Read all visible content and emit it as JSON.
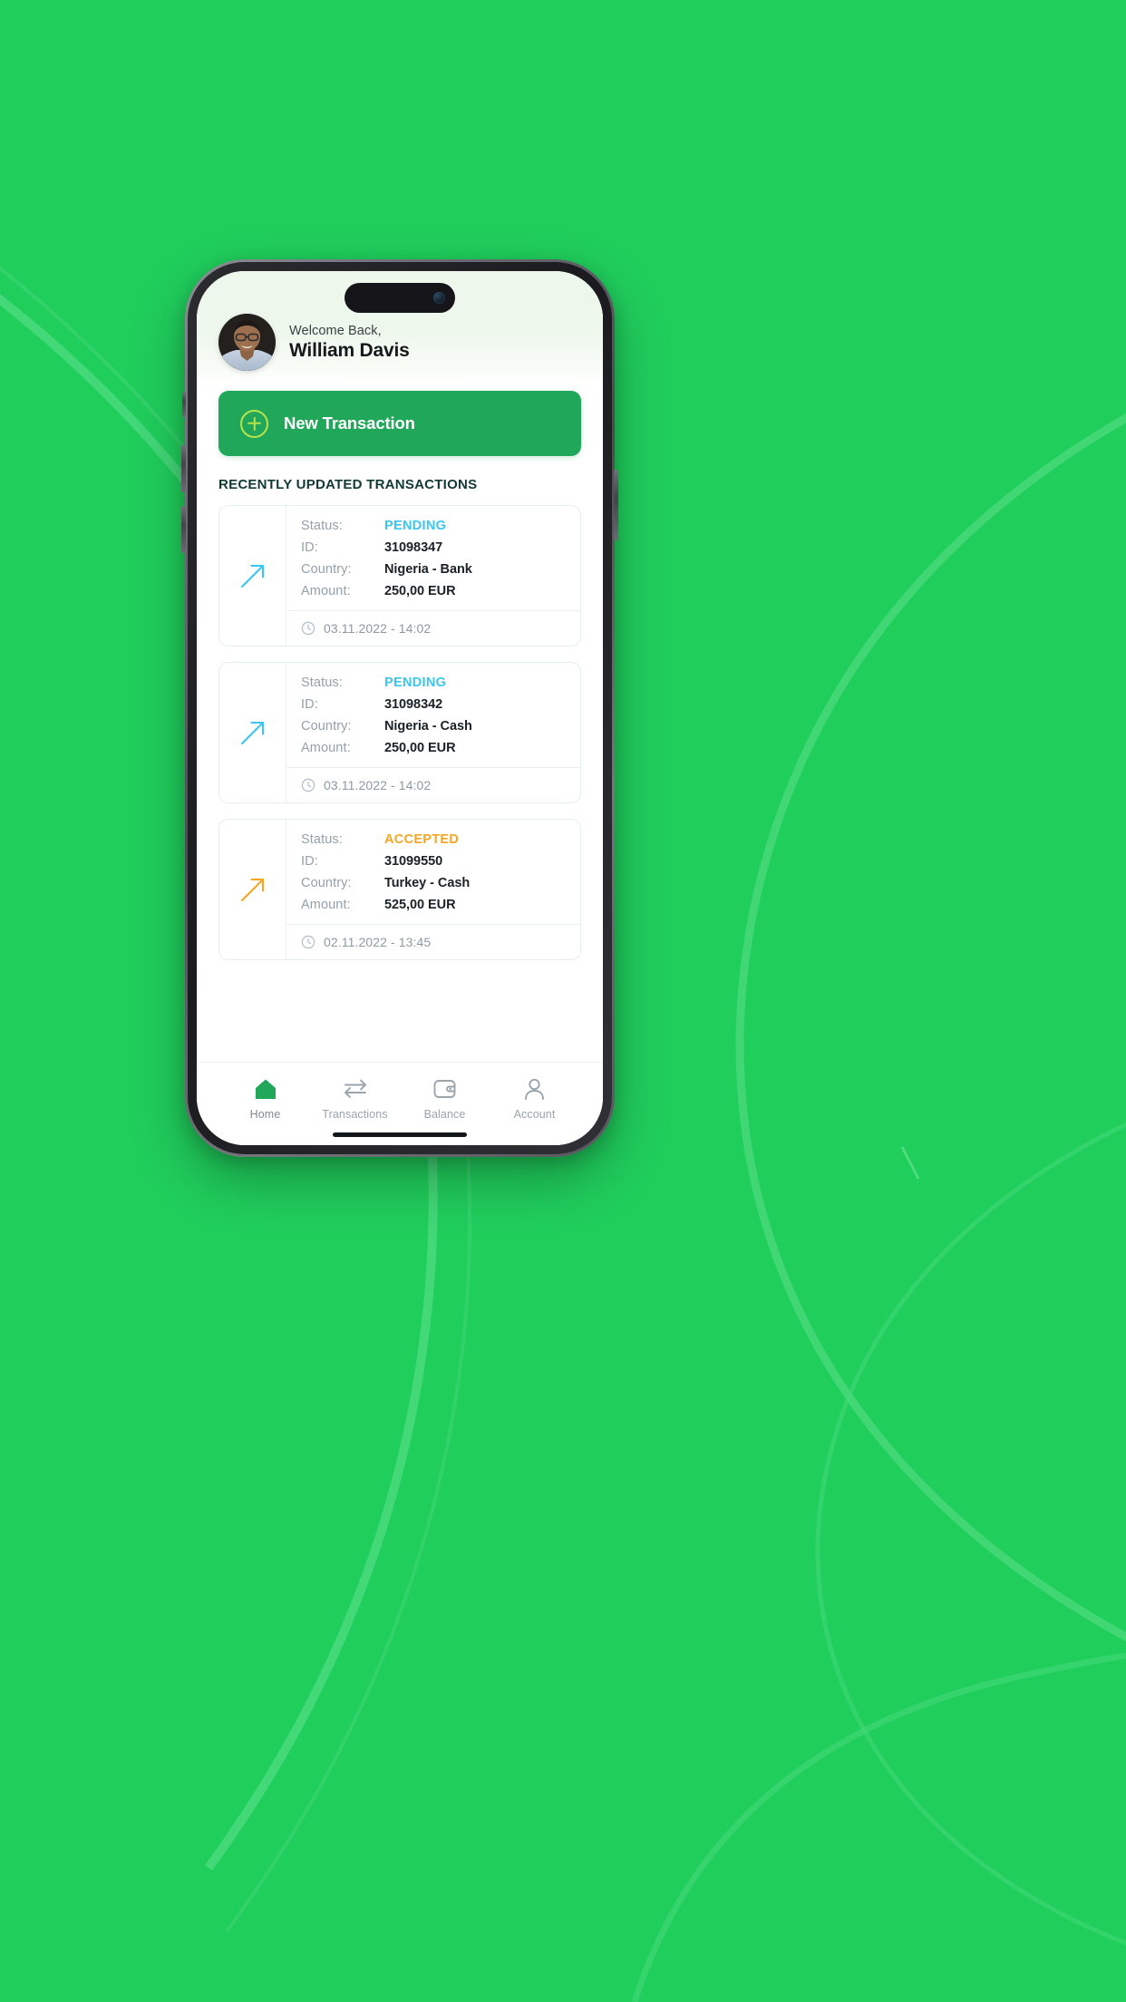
{
  "background": {
    "brand_green": "#20ce5c",
    "curve_color": "#46d977"
  },
  "device": {
    "frame": "iphone-mockup",
    "dynamic_island": "dynamic-island",
    "camera_icon": "camera-icon"
  },
  "header": {
    "avatar_icon": "user-avatar-photo",
    "greeting": "Welcome Back,",
    "user_name": "William Davis"
  },
  "actions": {
    "new_transaction_label": "New Transaction",
    "new_transaction_icon": "plus-circle-icon",
    "accent_color": "#20a75a",
    "plus_color": "#b6e24a"
  },
  "section": {
    "title": "RECENTLY UPDATED TRANSACTIONS",
    "title_color": "#123a33"
  },
  "labels": {
    "status": "Status:",
    "id": "ID:",
    "country": "Country:",
    "amount": "Amount:"
  },
  "status_colors": {
    "PENDING": "#3bc6f0",
    "ACCEPTED": "#f5a623"
  },
  "transactions": [
    {
      "arrow_icon": "arrow-up-right-icon",
      "arrow_color": "#3bc6f0",
      "status": "PENDING",
      "status_class": "status-pending",
      "id": "31098347",
      "country": "Nigeria - Bank",
      "amount": "250,00 EUR",
      "timestamp": "03.11.2022 - 14:02",
      "clock_icon": "clock-icon"
    },
    {
      "arrow_icon": "arrow-up-right-icon",
      "arrow_color": "#3bc6f0",
      "status": "PENDING",
      "status_class": "status-pending",
      "id": "31098342",
      "country": "Nigeria - Cash",
      "amount": "250,00 EUR",
      "timestamp": "03.11.2022 - 14:02",
      "clock_icon": "clock-icon"
    },
    {
      "arrow_icon": "arrow-up-right-icon",
      "arrow_color": "#f5a623",
      "status": "ACCEPTED",
      "status_class": "status-accepted",
      "id": "31099550",
      "country": "Turkey - Cash",
      "amount": "525,00 EUR",
      "timestamp": "02.11.2022 - 13:45",
      "clock_icon": "clock-icon"
    }
  ],
  "bottom_nav": {
    "items": [
      {
        "label": "Home",
        "icon": "home-icon",
        "active": true
      },
      {
        "label": "Transactions",
        "icon": "exchange-arrows-icon",
        "active": false
      },
      {
        "label": "Balance",
        "icon": "wallet-icon",
        "active": false
      },
      {
        "label": "Account",
        "icon": "person-icon",
        "active": false
      }
    ],
    "active_color": "#20a75a",
    "inactive_color": "#9aa4ad"
  }
}
